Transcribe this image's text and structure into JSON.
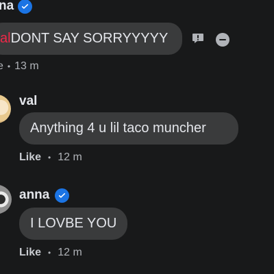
{
  "top_comment": {
    "author": "na",
    "mention": "al",
    "text": " DONT SAY SORRYYYYY",
    "time": "13 m",
    "meta_prefix": "e"
  },
  "replies": [
    {
      "author": "val",
      "text": "Anything 4 u lil taco muncher",
      "like_label": "Like",
      "time": "12 m"
    },
    {
      "author": "anna",
      "text": "I LOVBE YOU",
      "like_label": "Like",
      "time": "12 m"
    }
  ],
  "colors": {
    "background": "#18191a",
    "bubble": "#3a3b3c",
    "mention": "#f02849",
    "verified": "#1b74e4",
    "secondary_text": "#b0b3b8"
  }
}
